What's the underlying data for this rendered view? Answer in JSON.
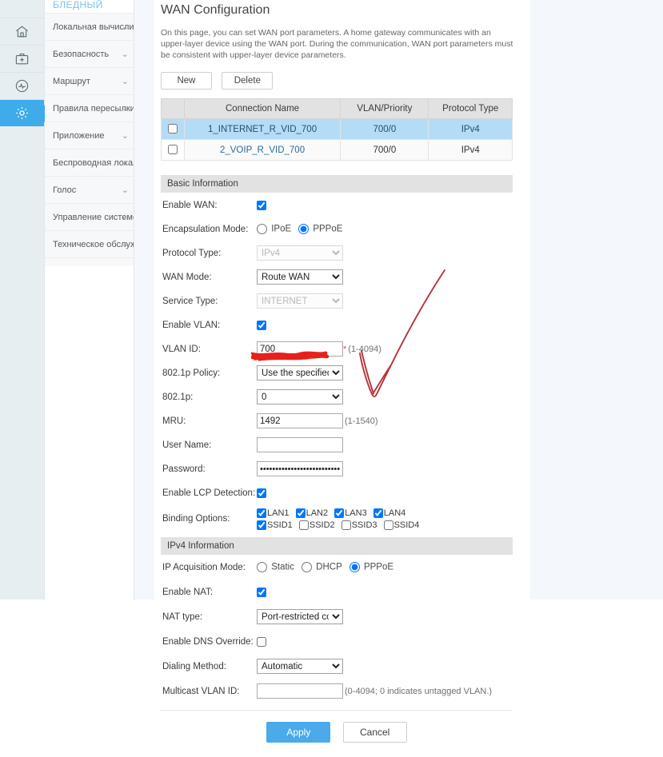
{
  "rail": {
    "items": [
      {
        "name": "home-icon",
        "label": "Home"
      },
      {
        "name": "diagnosis-icon",
        "label": "Diagnosis"
      },
      {
        "name": "status-icon",
        "label": "Status"
      },
      {
        "name": "settings-icon",
        "label": "Settings"
      }
    ]
  },
  "sidebar": {
    "brand": "БЛЕДНЫЙ",
    "chevron": "⌄",
    "items": [
      {
        "label": "Локальная вычислит"
      },
      {
        "label": "Безопасность"
      },
      {
        "label": "Маршрут"
      },
      {
        "label": "Правила пересылки"
      },
      {
        "label": "Приложение"
      },
      {
        "label": "Беспроводная локалі"
      },
      {
        "label": "Голос"
      },
      {
        "label": "Управление системої"
      },
      {
        "label": "Техническое обслужі"
      }
    ]
  },
  "page": {
    "title": "WAN Configuration",
    "description": "On this page, you can set WAN port parameters. A home gateway communicates with an upper-layer device using the WAN port. During the communication, WAN port parameters must be consistent with upper-layer device parameters."
  },
  "toolbar": {
    "new_label": "New",
    "delete_label": "Delete"
  },
  "table": {
    "headers": [
      "",
      "Connection Name",
      "VLAN/Priority",
      "Protocol Type"
    ],
    "rows": [
      {
        "selected": true,
        "checked": false,
        "name": "1_INTERNET_R_VID_700",
        "vlan": "700/0",
        "protocol": "IPv4"
      },
      {
        "selected": false,
        "checked": false,
        "name": "2_VOIP_R_VID_700",
        "vlan": "700/0",
        "protocol": "IPv4"
      }
    ]
  },
  "basic": {
    "section_title": "Basic Information",
    "enable_wan": {
      "label": "Enable WAN:",
      "checked": true
    },
    "encapsulation": {
      "label": "Encapsulation Mode:",
      "options": [
        "IPoE",
        "PPPoE"
      ],
      "selected": "PPPoE"
    },
    "protocol_type": {
      "label": "Protocol Type:",
      "value": "IPv4",
      "disabled": true
    },
    "wan_mode": {
      "label": "WAN Mode:",
      "value": "Route WAN",
      "disabled": false
    },
    "service_type": {
      "label": "Service Type:",
      "value": "INTERNET",
      "disabled": true
    },
    "enable_vlan": {
      "label": "Enable VLAN:",
      "checked": true
    },
    "vlan_id": {
      "label": "VLAN ID:",
      "value": "700",
      "required_mark": "*",
      "hint": "(1-4094)"
    },
    "p_policy": {
      "label": "802.1p Policy:",
      "value": "Use the specified valu"
    },
    "p_value": {
      "label": "802.1p:",
      "value": "0"
    },
    "mru": {
      "label": "MRU:",
      "value": "1492",
      "hint": "(1-1540)"
    },
    "user_name": {
      "label": "User Name:",
      "value": "",
      "redacted": true
    },
    "password": {
      "label": "Password:",
      "value": "••••••••••••••••••••••••••"
    },
    "lcp": {
      "label": "Enable LCP Detection:",
      "checked": true
    },
    "binding": {
      "label": "Binding Options:",
      "options": [
        {
          "label": "LAN1",
          "checked": true
        },
        {
          "label": "LAN2",
          "checked": true
        },
        {
          "label": "LAN3",
          "checked": true
        },
        {
          "label": "LAN4",
          "checked": true
        },
        {
          "label": "SSID1",
          "checked": true
        },
        {
          "label": "SSID2",
          "checked": false
        },
        {
          "label": "SSID3",
          "checked": false
        },
        {
          "label": "SSID4",
          "checked": false
        }
      ]
    }
  },
  "ipv4": {
    "section_title": "IPv4 Information",
    "acquisition": {
      "label": "IP Acquisition Mode:",
      "options": [
        "Static",
        "DHCP",
        "PPPoE"
      ],
      "selected": "PPPoE"
    },
    "enable_nat": {
      "label": "Enable NAT:",
      "checked": true
    },
    "nat_type": {
      "label": "NAT type:",
      "value": "Port-restricted cone N"
    },
    "dns_override": {
      "label": "Enable DNS Override:",
      "checked": false
    },
    "dialing_method": {
      "label": "Dialing Method:",
      "value": "Automatic"
    },
    "multicast_vlan": {
      "label": "Multicast VLAN ID:",
      "value": "",
      "hint": "(0-4094; 0 indicates untagged VLAN.)"
    }
  },
  "actions": {
    "apply_label": "Apply",
    "cancel_label": "Cancel"
  },
  "colors": {
    "accent": "#4aaaea",
    "rail_active": "#3eacea",
    "row_selected": "#b4dcf6",
    "section_bar": "#e2e2e2",
    "annotation_red": "#c0392b",
    "redaction_red": "#e8201a"
  }
}
